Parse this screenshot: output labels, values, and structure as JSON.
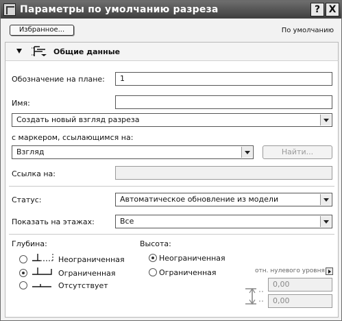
{
  "window": {
    "title": "Параметры по умолчанию разреза",
    "help_label": "?",
    "close_label": "X"
  },
  "top": {
    "favorites_label": "Избранное...",
    "default_label": "По умолчанию"
  },
  "section": {
    "title": "Общие данные"
  },
  "fields": {
    "plan_id_label": "Обозначение на плане:",
    "plan_id_value": "1",
    "name_label": "Имя:",
    "name_value": "",
    "create_view_value": "Создать новый взгляд разреза",
    "marker_ref_label": "с маркером, ссылающимся на:",
    "view_value": "Взгляд",
    "find_label": "Найти...",
    "ref_label": "Ссылка на:",
    "ref_value": ""
  },
  "status": {
    "status_label": "Статус:",
    "status_value": "Автоматическое обновление из модели",
    "stories_label": "Показать на этажах:",
    "stories_value": "Все"
  },
  "depth": {
    "label": "Глубина:",
    "options": [
      "Неограниченная",
      "Ограниченная",
      "Отсутствует"
    ],
    "selected": 1
  },
  "height": {
    "label": "Высота:",
    "options": [
      "Неограниченная",
      "Ограниченная"
    ],
    "selected": 0,
    "level_ref_label": "отн. нулевого уровня",
    "top_value": "0,00",
    "bottom_value": "0,00"
  }
}
